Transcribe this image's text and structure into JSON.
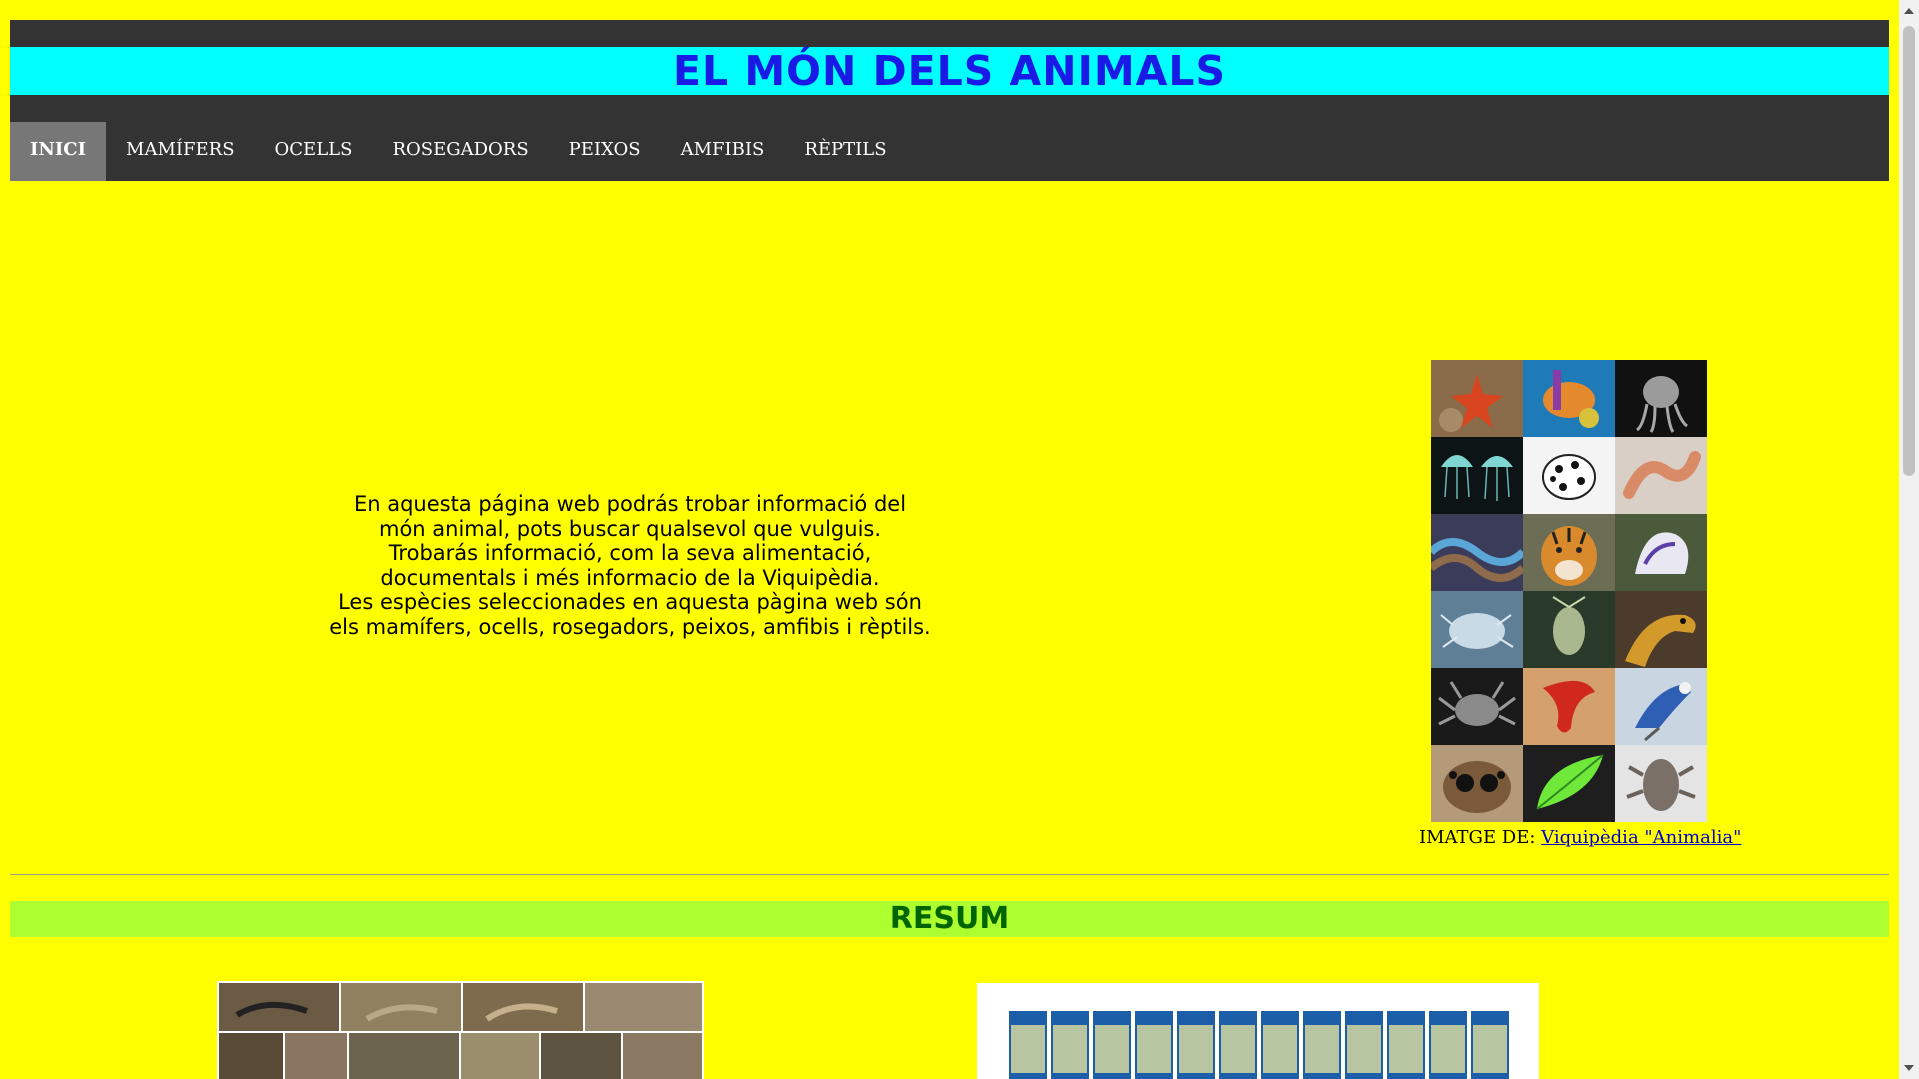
{
  "header": {
    "title": "EL MÓN DELS ANIMALS"
  },
  "nav": {
    "items": [
      {
        "label": "INICI",
        "active": true
      },
      {
        "label": "MAMÍFERS"
      },
      {
        "label": "OCELLS"
      },
      {
        "label": "ROSEGADORS"
      },
      {
        "label": "PEIXOS"
      },
      {
        "label": "AMFIBIS"
      },
      {
        "label": "RÈPTILS"
      }
    ]
  },
  "intro": {
    "lines": [
      "En aquesta página web podrás trobar informació del",
      "món animal, pots buscar qualsevol que vulguis.",
      "Trobarás informació, com la seva alimentació,",
      "documentals i més informacio de la Viquipèdia.",
      "Les espècies seleccionades en aquesta pàgina web són",
      "els mamífers, ocells, rosegadors, peixos, amfibis i rèptils."
    ]
  },
  "image_credit": {
    "prefix": "IMATGE DE: ",
    "link_text": "Viquipèdia \"Animalia\""
  },
  "section": {
    "title": "RESUM"
  },
  "colors": {
    "page_bg": "#ffff00",
    "title_band": "#00ffff",
    "title_text": "#1a1ae6",
    "nav_bg": "#333333",
    "nav_active": "#777777",
    "resum_band": "#adff2f",
    "resum_text": "#006400"
  }
}
